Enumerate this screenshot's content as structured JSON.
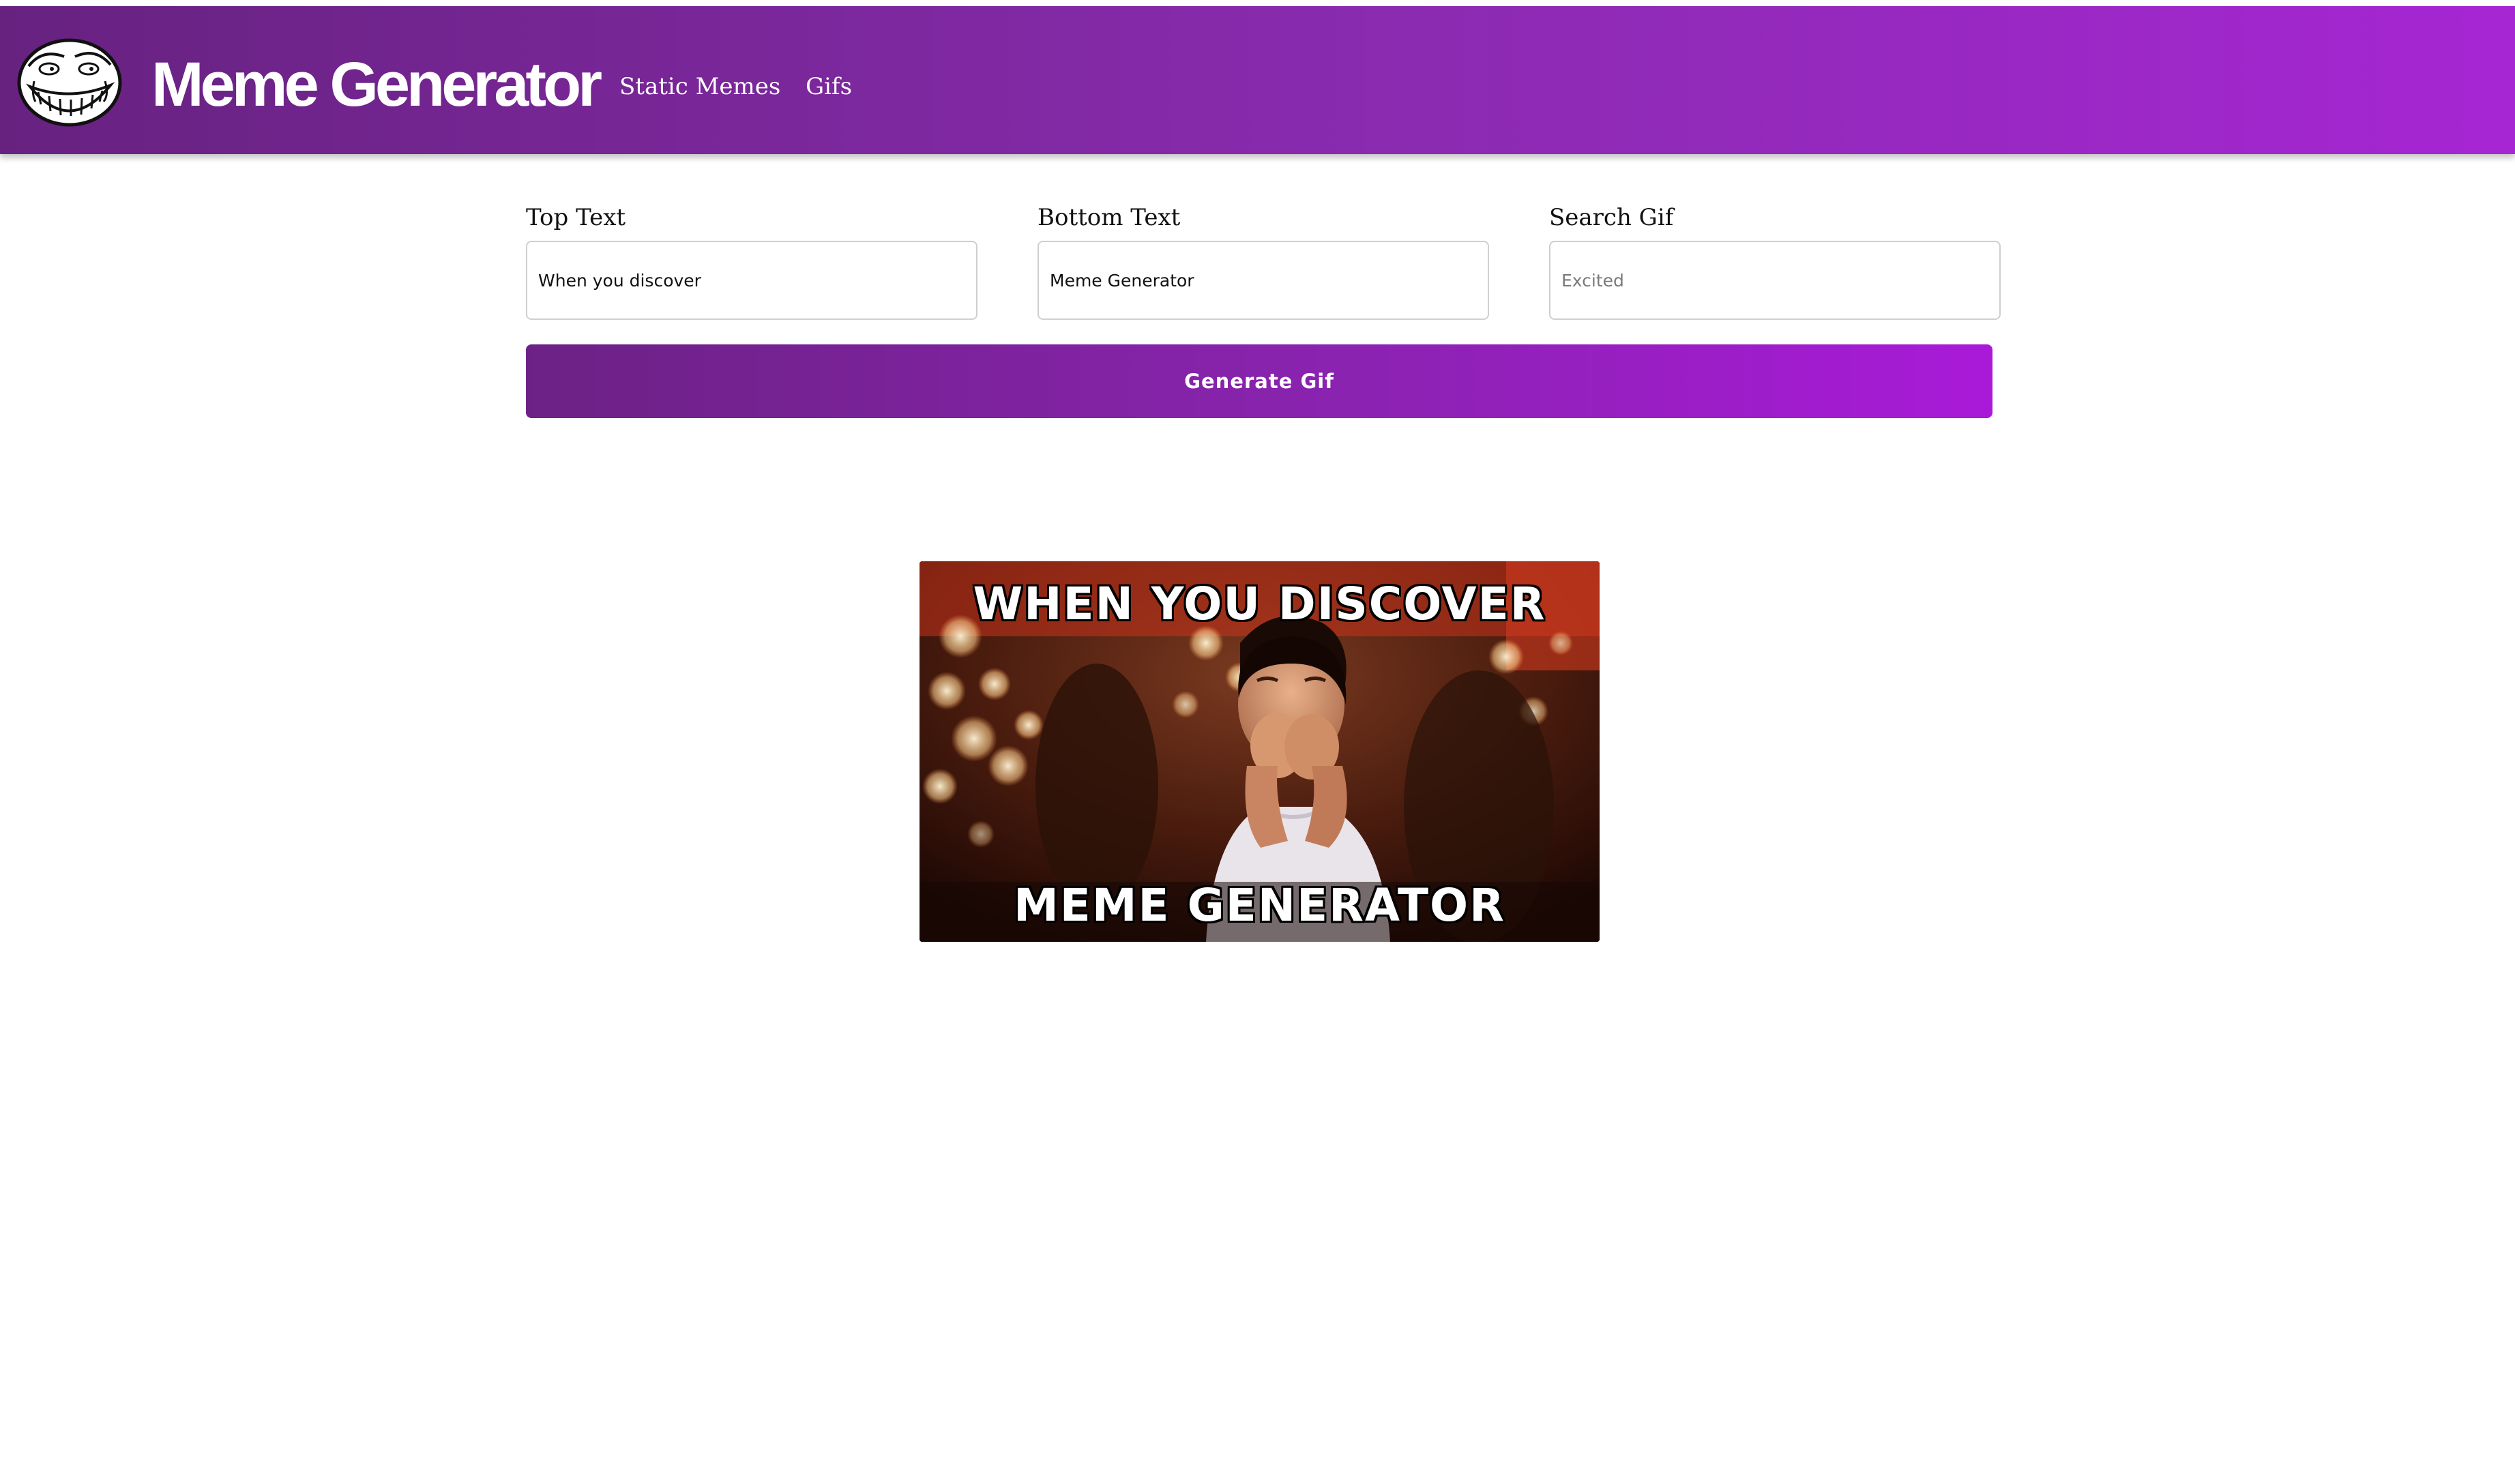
{
  "header": {
    "brand": "Meme Generator",
    "nav": {
      "static_memes": "Static Memes",
      "gifs": "Gifs"
    },
    "logo_icon": "troll-face-icon"
  },
  "form": {
    "top_text": {
      "label": "Top Text",
      "value": "When you discover"
    },
    "bottom_text": {
      "label": "Bottom Text",
      "value": "Meme Generator"
    },
    "search_gif": {
      "label": "Search Gif",
      "placeholder": "Excited",
      "value": ""
    },
    "generate_label": "Generate Gif"
  },
  "meme": {
    "top_caption": "WHEN YOU DISCOVER",
    "bottom_caption": "MEME GENERATOR"
  },
  "colors": {
    "accent_start": "#672280",
    "accent_end": "#a626d3"
  }
}
